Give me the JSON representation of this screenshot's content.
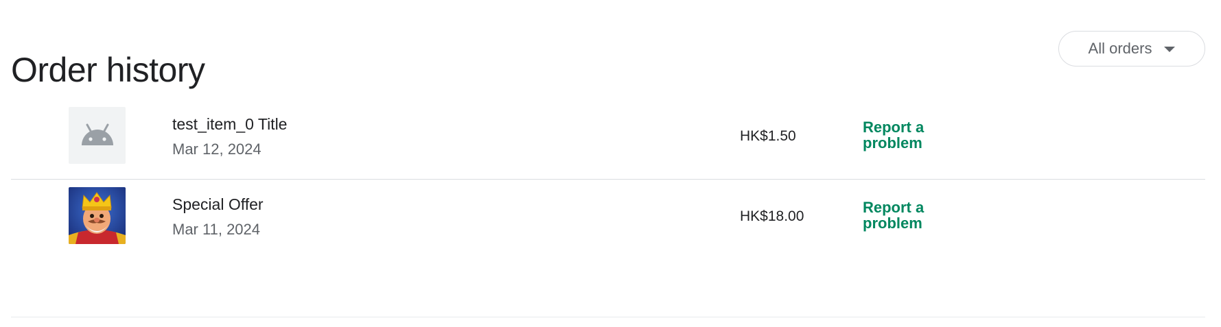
{
  "header": {
    "title": "Order history",
    "filter_label": "All orders",
    "filter_icon": "caret-down-icon"
  },
  "orders": [
    {
      "title": "test_item_0 Title",
      "date": "Mar 12, 2024",
      "price": "HK$1.50",
      "report_label": "Report a problem",
      "thumbnail_icon": "android-icon"
    },
    {
      "title": "Special Offer",
      "date": "Mar 11, 2024",
      "price": "HK$18.00",
      "report_label": "Report a problem",
      "thumbnail_icon": "king-character-icon"
    }
  ],
  "colors": {
    "link": "#01875f",
    "divider": "#dadce0",
    "secondary_text": "#5f6368"
  }
}
